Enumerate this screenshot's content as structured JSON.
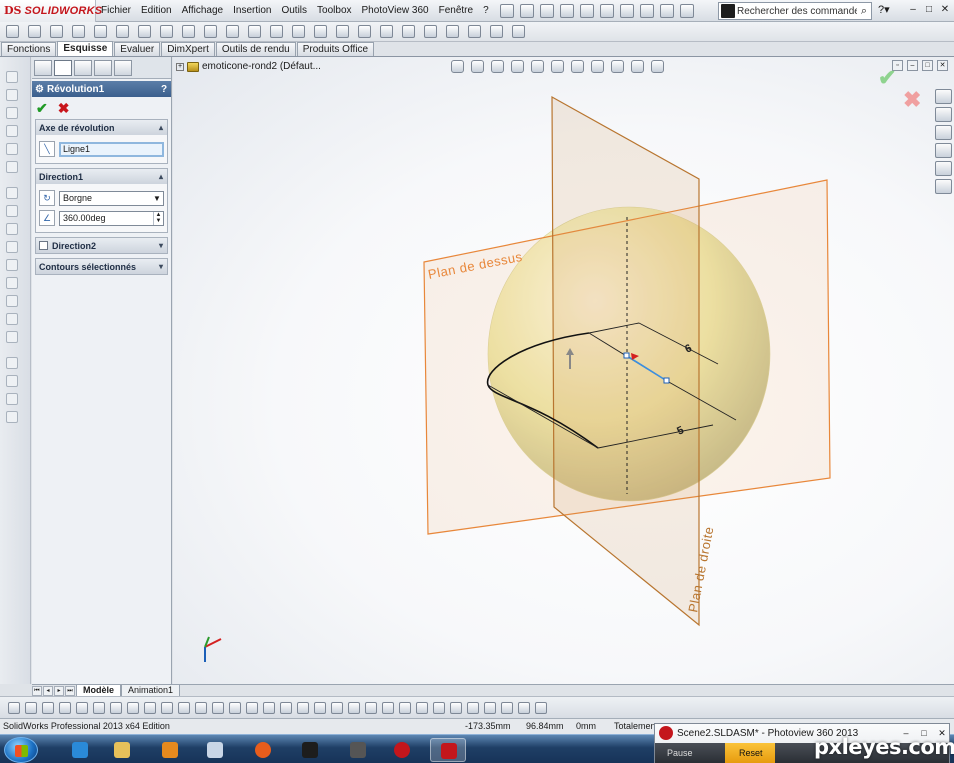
{
  "app": {
    "logo_ds": "DS",
    "logo_name": "SOLIDWORKS"
  },
  "menu": [
    "Fichier",
    "Edition",
    "Affichage",
    "Insertion",
    "Outils",
    "Toolbox",
    "PhotoView 360",
    "Fenêtre",
    "?"
  ],
  "search": {
    "placeholder": "Rechercher des commandes"
  },
  "command_tabs": [
    {
      "label": "Fonctions",
      "active": false
    },
    {
      "label": "Esquisse",
      "active": true
    },
    {
      "label": "Evaluer",
      "active": false
    },
    {
      "label": "DimXpert",
      "active": false
    },
    {
      "label": "Outils de rendu",
      "active": false
    },
    {
      "label": "Produits Office",
      "active": false
    }
  ],
  "property_manager": {
    "title": "Révolution1",
    "help": "?",
    "axis_group": {
      "title": "Axe de révolution",
      "value": "Ligne1"
    },
    "direction1": {
      "title": "Direction1",
      "type": "Borgne",
      "angle": "360.00deg"
    },
    "direction2": {
      "title": "Direction2"
    },
    "contours": {
      "title": "Contours sélectionnés"
    }
  },
  "tree": {
    "root": "emoticone-rond2  (Défaut..."
  },
  "planes": {
    "top": "Plan de dessus",
    "right": "Plan de droite"
  },
  "dimensions": {
    "d1": "6",
    "d2": "5"
  },
  "model_tabs": [
    {
      "label": "Modèle",
      "active": true
    },
    {
      "label": "Animation1",
      "active": false
    }
  ],
  "status": {
    "edition": "SolidWorks Professional 2013 x64 Edition",
    "x": "-173.35mm",
    "y": "96.84mm",
    "z": "0mm",
    "state": "Totalemen"
  },
  "photoview": {
    "title": "Scene2.SLDASM* - Photoview 360 2013",
    "pause": "Pause",
    "reset": "Reset"
  },
  "watermark": "pxleyes.com",
  "colors": {
    "accent_orange": "#e8873a",
    "plane_right": "#b8752f",
    "sphere": "#f0ecae",
    "taskbar": "#1f3f66"
  }
}
